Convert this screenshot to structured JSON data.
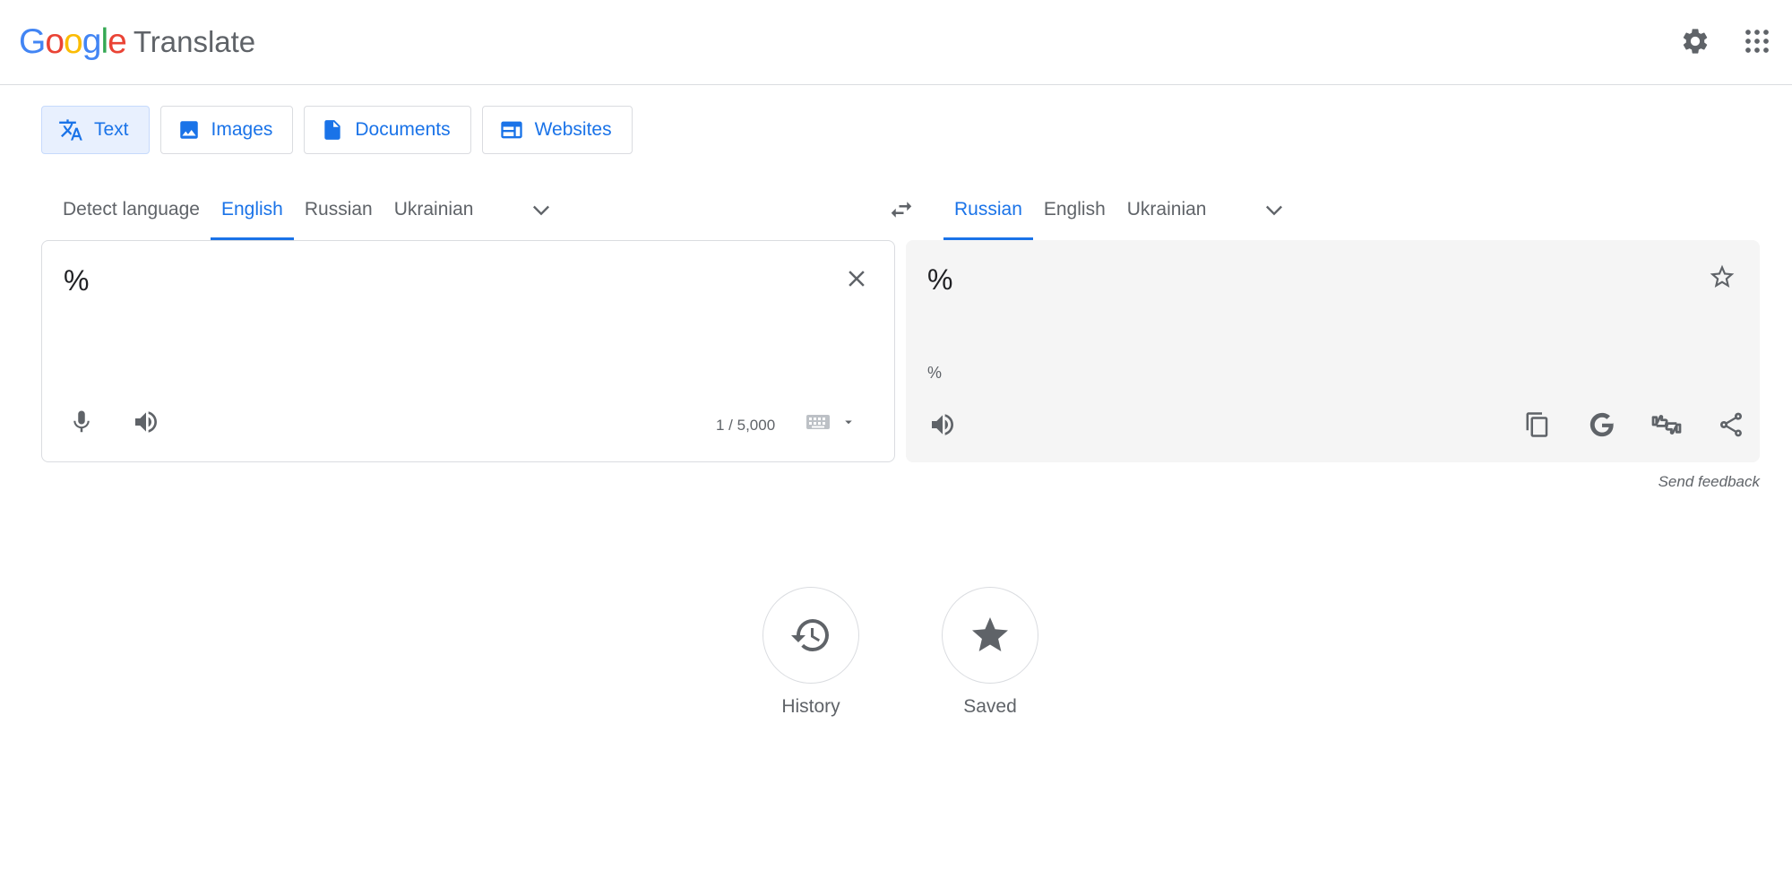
{
  "header": {
    "logo_letters": [
      "G",
      "o",
      "o",
      "g",
      "l",
      "e"
    ],
    "logo_colors": [
      "#4285F4",
      "#EA4335",
      "#FBBC05",
      "#4285F4",
      "#34A853",
      "#EA4335"
    ],
    "product_name": "Translate",
    "settings_icon": "gear-icon",
    "apps_icon": "apps-grid-icon"
  },
  "modes": {
    "text": "Text",
    "images": "Images",
    "documents": "Documents",
    "websites": "Websites",
    "active": "Text"
  },
  "source_langs": {
    "detect": "Detect language",
    "english": "English",
    "russian": "Russian",
    "ukrainian": "Ukrainian",
    "active": "English"
  },
  "target_langs": {
    "russian": "Russian",
    "english": "English",
    "ukrainian": "Ukrainian",
    "active": "Russian"
  },
  "source": {
    "text": "%",
    "char_count": "1 / 5,000"
  },
  "target": {
    "text": "%",
    "transliteration": "%"
  },
  "feedback": "Send feedback",
  "bottom": {
    "history": "History",
    "saved": "Saved"
  },
  "colors": {
    "accent": "#1a73e8",
    "icon": "#5f6368",
    "target_bg": "#f5f5f5"
  }
}
